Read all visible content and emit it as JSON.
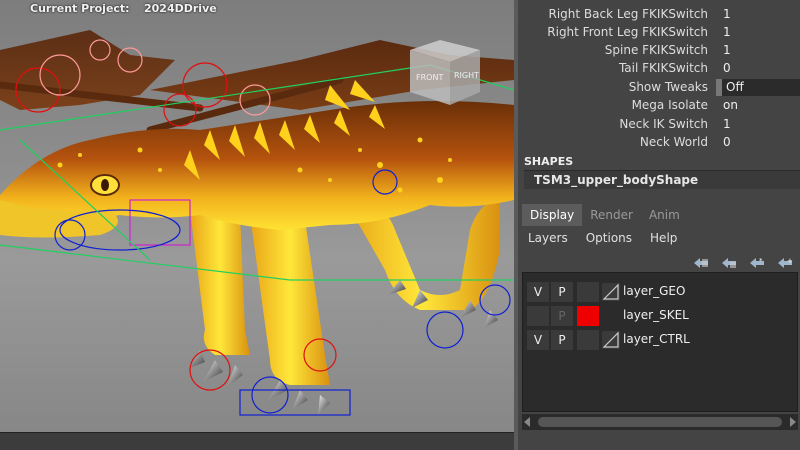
{
  "hud": {
    "project_label": "Current Project:",
    "project_value": "2024DDrive"
  },
  "viewcube": {
    "front_label": "FRONT",
    "right_label": "RIGHT"
  },
  "channel_box": {
    "attributes": [
      {
        "name": "Right Back Leg FKIKSwitch",
        "value": "1"
      },
      {
        "name": "Right Front Leg FKIKSwitch",
        "value": "1"
      },
      {
        "name": "Spine FKIKSwitch",
        "value": "1"
      },
      {
        "name": "Tail FKIKSwitch",
        "value": "0"
      },
      {
        "name": "Show Tweaks",
        "value": "Off"
      },
      {
        "name": "Mega Isolate",
        "value": "on"
      },
      {
        "name": "Neck IK Switch",
        "value": "1"
      },
      {
        "name": "Neck World",
        "value": "0"
      }
    ],
    "shapes_header": "SHAPES",
    "shape_name": "TSM3_upper_bodyShape"
  },
  "layer_editor": {
    "tabs": [
      "Display",
      "Render",
      "Anim"
    ],
    "active_tab": "Display",
    "menus": [
      "Layers",
      "Options",
      "Help"
    ],
    "layers": [
      {
        "v": "V",
        "p": "P",
        "name": "layer_GEO",
        "color": "",
        "enabled": true
      },
      {
        "v": "",
        "p": "P",
        "name": "layer_SKEL",
        "color": "#ff0000",
        "enabled": false
      },
      {
        "v": "V",
        "p": "P",
        "name": "layer_CTRL",
        "color": "",
        "enabled": true
      }
    ]
  },
  "colors": {
    "skel_layer": "#ff0000",
    "panel_bg": "#444444",
    "list_bg": "#2b2b2b"
  }
}
